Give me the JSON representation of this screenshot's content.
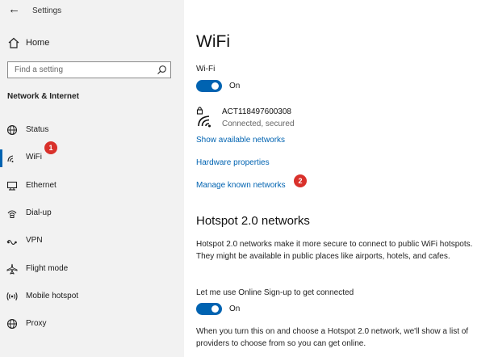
{
  "window": {
    "title": "Settings"
  },
  "sidebar": {
    "home_label": "Home",
    "search_placeholder": "Find a setting",
    "section_title": "Network & Internet",
    "items": [
      {
        "label": "Status",
        "icon": "globe-icon"
      },
      {
        "label": "WiFi",
        "icon": "wifi-icon",
        "selected": true
      },
      {
        "label": "Ethernet",
        "icon": "ethernet-icon"
      },
      {
        "label": "Dial-up",
        "icon": "dial-up-icon"
      },
      {
        "label": "VPN",
        "icon": "vpn-icon"
      },
      {
        "label": "Flight mode",
        "icon": "airplane-icon"
      },
      {
        "label": "Mobile hotspot",
        "icon": "hotspot-icon"
      },
      {
        "label": "Proxy",
        "icon": "proxy-globe-icon"
      }
    ]
  },
  "main": {
    "title": "WiFi",
    "wifi_toggle": {
      "label": "Wi-Fi",
      "state": "On"
    },
    "network": {
      "name": "ACT118497600308",
      "status": "Connected, secured"
    },
    "links": {
      "show_available": "Show available networks",
      "hardware_properties": "Hardware properties",
      "manage_known": "Manage known networks"
    },
    "hotspot": {
      "heading": "Hotspot 2.0 networks",
      "description": "Hotspot 2.0 networks make it more secure to connect to public WiFi hotspots. They might be available in public places like airports, hotels, and cafes.",
      "signup_label": "Let me use Online Sign-up to get connected",
      "signup_state": "On",
      "footer": "When you turn this on and choose a Hotspot 2.0 network, we'll show a list of providers to choose from so you can get online."
    }
  },
  "annotations": {
    "badge1": "1",
    "badge2": "2"
  },
  "colors": {
    "accent": "#0063b1",
    "badge": "#d9312b",
    "sidebar_bg": "#f2f2f2"
  }
}
